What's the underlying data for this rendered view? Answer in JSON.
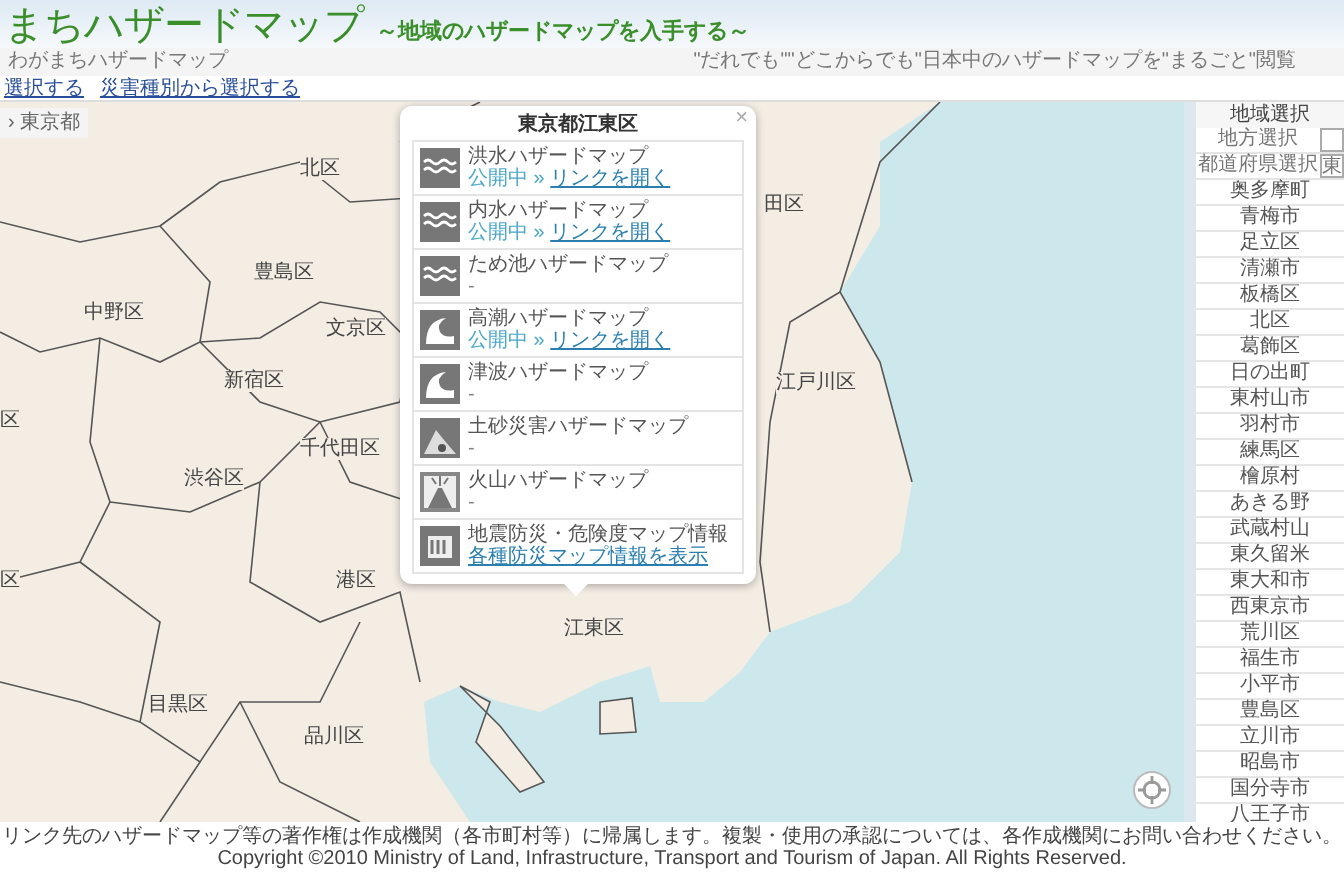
{
  "header": {
    "title": "まちハザードマップ",
    "subtitle": "～地域のハザードマップを入手する～"
  },
  "subheader": {
    "breadcrumb": "わがまちハザードマップ",
    "tagline": "\"だれでも\"\"どこからでも\"日本中のハザードマップを\"まるごと\"閲覧"
  },
  "nav_links": [
    {
      "label": "選択する"
    },
    {
      "label": "災害種別から選択する"
    }
  ],
  "map": {
    "breadcrumb": "› 東京都",
    "district_labels": [
      "北区",
      "豊島区",
      "中野区",
      "文京区",
      "新宿区",
      "千代田区",
      "渋谷区",
      "港区",
      "目黒区",
      "品川区",
      "江戸川区",
      "江東区",
      "田区",
      "区",
      "区"
    ]
  },
  "popup": {
    "title": "東京都江東区",
    "close": "×",
    "items": [
      {
        "kind": "flood",
        "name": "洪水ハザードマップ",
        "status": "公開中 »",
        "link": "リンクを開く"
      },
      {
        "kind": "flood",
        "name": "内水ハザードマップ",
        "status": "公開中 »",
        "link": "リンクを開く"
      },
      {
        "kind": "flood",
        "name": "ため池ハザードマップ",
        "status": "-"
      },
      {
        "kind": "tsunami",
        "name": "高潮ハザードマップ",
        "status": "公開中 »",
        "link": "リンクを開く"
      },
      {
        "kind": "tsunami",
        "name": "津波ハザードマップ",
        "status": "-"
      },
      {
        "kind": "landslide",
        "name": "土砂災害ハザードマップ",
        "status": "-"
      },
      {
        "kind": "volcano",
        "name": "火山ハザードマップ",
        "status": "-"
      },
      {
        "kind": "info",
        "name": "地震防災・危険度マップ情報",
        "link": "各種防災マップ情報を表示"
      }
    ]
  },
  "region_panel": {
    "title": "地域選択",
    "fields": [
      {
        "label": "地方選択"
      },
      {
        "label": "都道府県選択",
        "value": "東"
      }
    ],
    "cities": [
      "奥多摩町",
      "青梅市",
      "足立区",
      "清瀬市",
      "板橋区",
      "北区",
      "葛飾区",
      "日の出町",
      "東村山市",
      "羽村市",
      "練馬区",
      "檜原村",
      "あきる野",
      "武蔵村山",
      "東久留米",
      "東大和市",
      "西東京市",
      "荒川区",
      "福生市",
      "小平市",
      "豊島区",
      "立川市",
      "昭島市",
      "国分寺市",
      "八王子市"
    ]
  },
  "footer": {
    "notice": "リンク先のハザードマップ等の著作権は作成機関（各市町村等）に帰属します。複製・使用の承認については、各作成機関にお問い合わせください。",
    "copyright": "Copyright ©2010 Ministry of Land, Infrastructure, Transport and Tourism of Japan. All Rights Reserved."
  }
}
